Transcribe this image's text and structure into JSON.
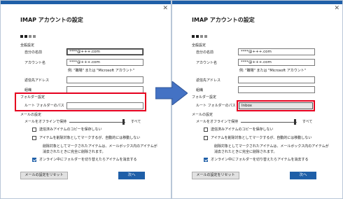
{
  "left": {
    "title": "IMAP アカウントの設定",
    "general_heading": "全般設定",
    "name_label": "自分の名前",
    "name_value": "****@+++.com",
    "account_label": "アカウント名",
    "account_value": "****@+++.com",
    "example": "例: \"職場\" または \"Microsoft アカウント\"",
    "reply_label": "返信先アドレス",
    "org_label": "組織",
    "folder_heading": "フォルダー設定",
    "root_label": "ルート フォルダーのパス",
    "root_value": "",
    "mail_heading": "メールの設定",
    "offline_label": "メールをオフラインで保持",
    "offline_value": "すべて",
    "cb1": "送信済みアイテムのコピーを保存しない",
    "cb2": "アイテムを削除対象としてマークするが、自動的には移動しない",
    "note1": "削除対象としてマークされたアイテムは、メールボックス内のアイテムが",
    "note2": "消去されたときに完全に削除されます。",
    "cb3": "オンライン中にフォルダーを切り替えたらアイテムを消去する",
    "reset": "メールの設定をリセット",
    "next": "次へ"
  },
  "right": {
    "title": "IMAP アカウントの設定",
    "general_heading": "全般設定",
    "name_label": "自分の名前",
    "name_value": "****@+++.com",
    "account_label": "アカウント名",
    "account_value": "****@+++.com",
    "example": "例: \"職場\" または \"Microsoft アカウント\"",
    "reply_label": "返信先アドレス",
    "org_label": "組織",
    "folder_heading": "フォルダー設定",
    "root_label": "ルート フォルダーのパス",
    "root_value": "Inbox",
    "mail_heading": "メールの設定",
    "offline_label": "メールをオフラインで保持",
    "offline_value": "すべて",
    "cb1": "送信済みアイテムのコピーを保存しない",
    "cb2": "アイテムを削除対象としてマークするが、自動的には移動しない",
    "note1": "削除対象としてマークされたアイテムは、メールボックス内のアイテムが",
    "note2": "消去されたときに完全に削除されます。",
    "cb3": "オンライン中にフォルダーを切り替えたらアイテムを消去する",
    "reset": "メールの設定をリセット",
    "next": "次へ"
  },
  "colors": {
    "accent": "#1f5fa8",
    "highlight": "#e5001e",
    "arrow": "#4472c4"
  },
  "icons": {
    "close": "close-icon",
    "arrow": "right-arrow-icon",
    "check": "checkmark-icon"
  }
}
